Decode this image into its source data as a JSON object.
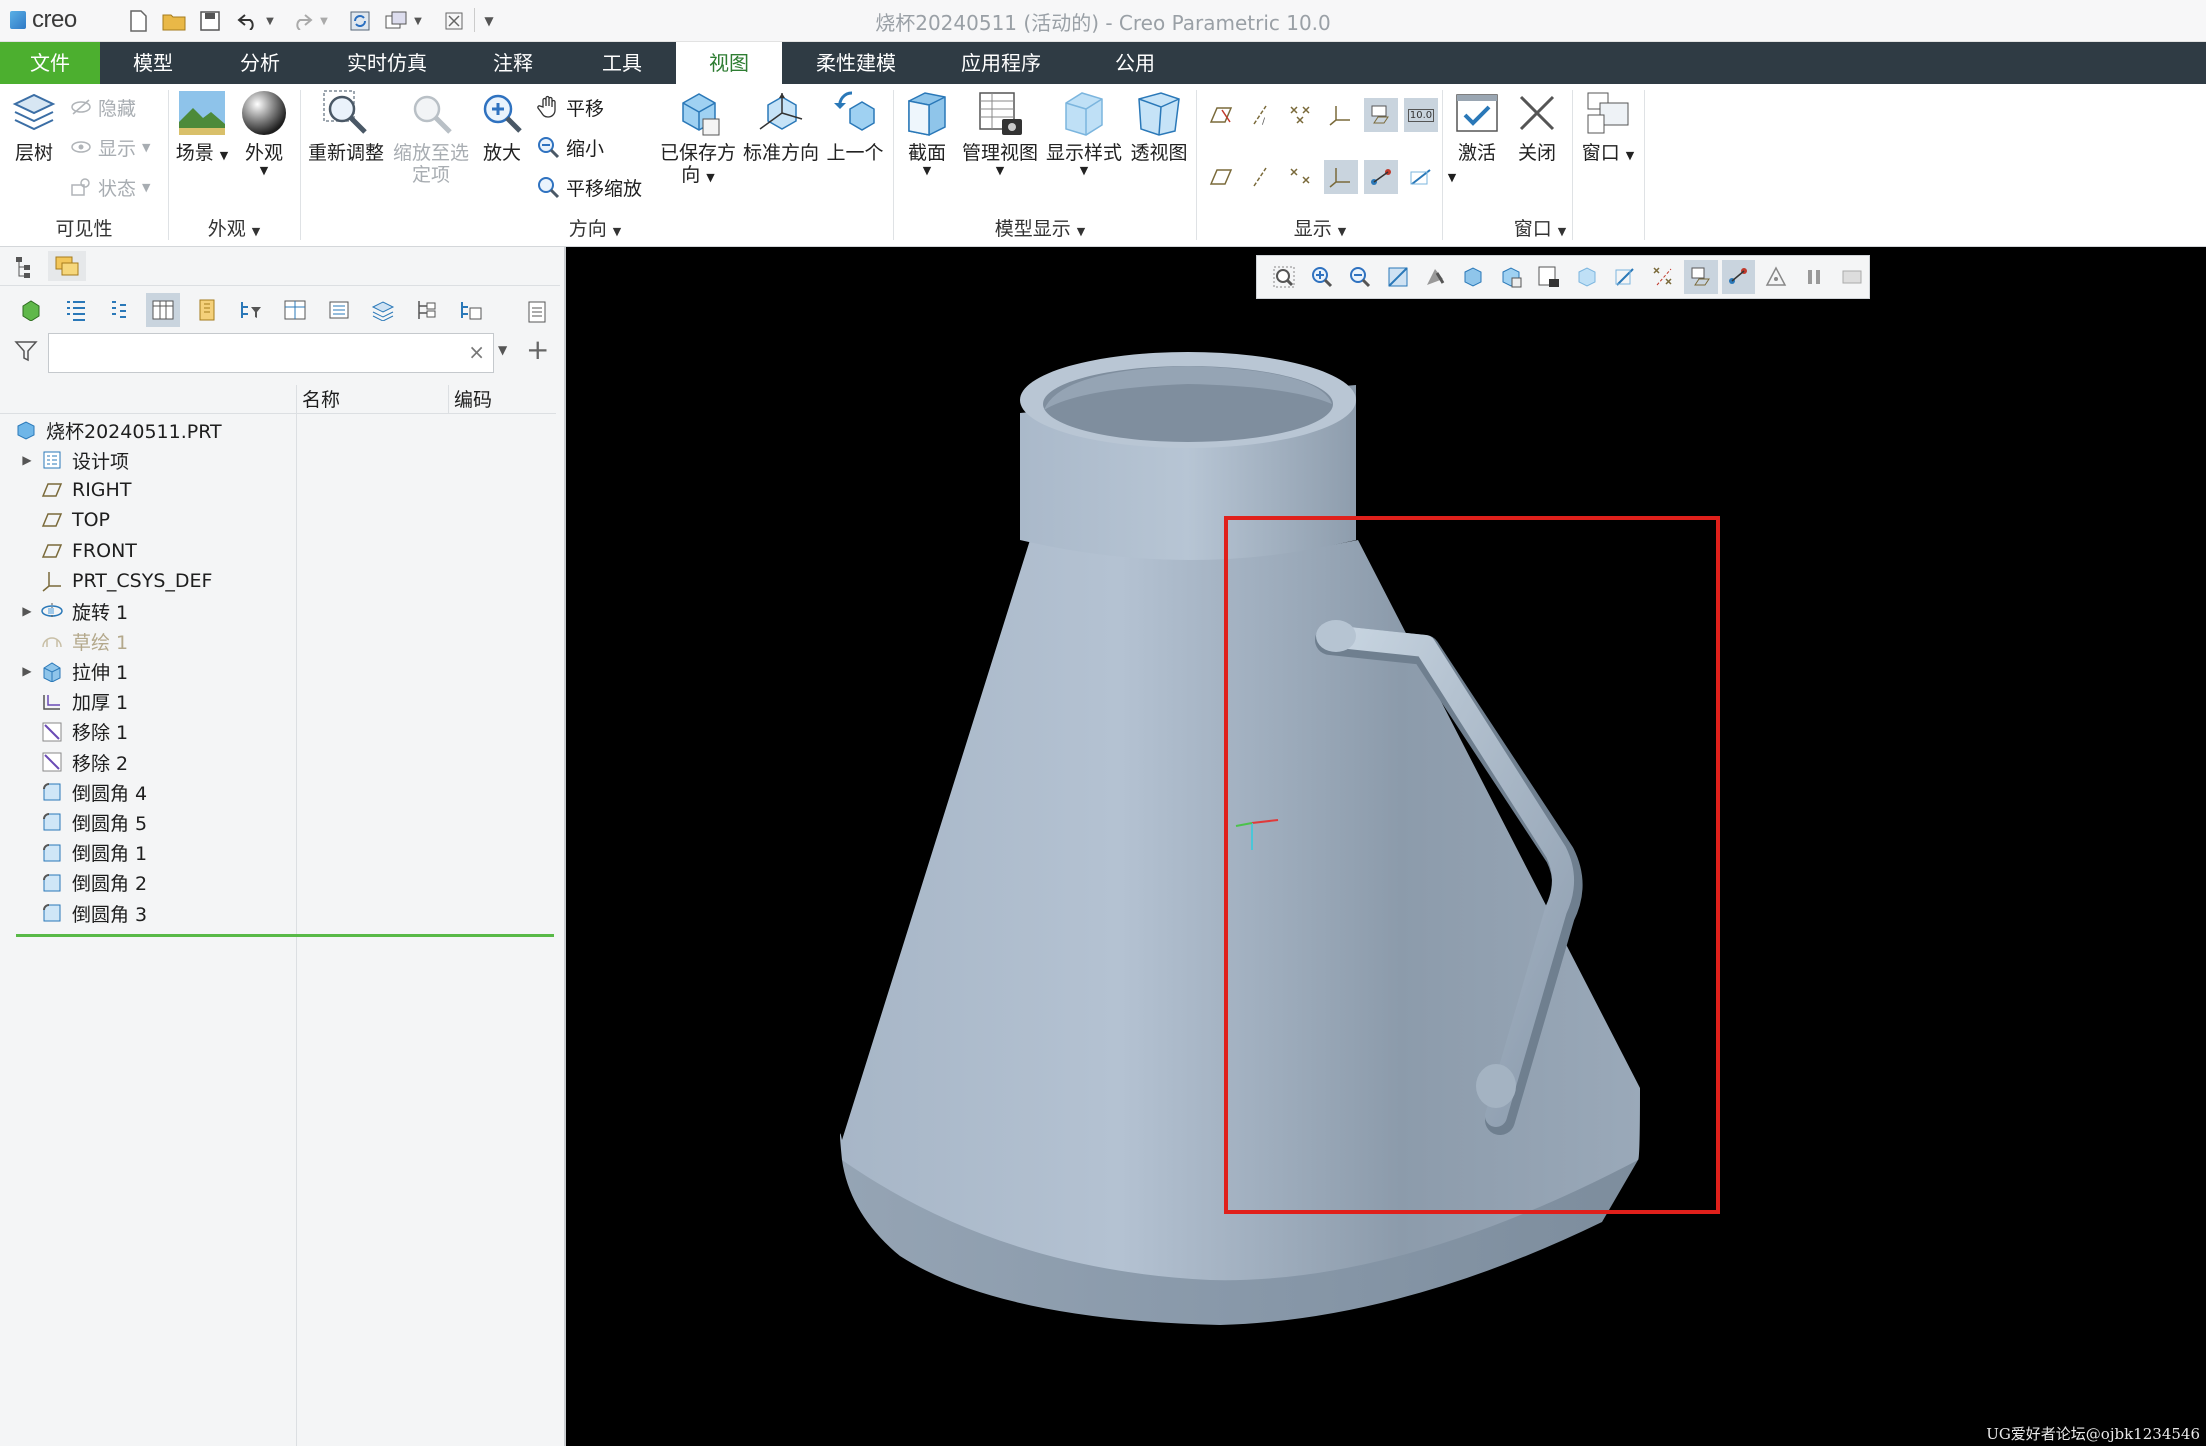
{
  "titlebar": {
    "logo_text": "creo",
    "window_title": "烧杯20240511 (活动的) - Creo Parametric 10.0"
  },
  "tabs": [
    {
      "label": "文件"
    },
    {
      "label": "模型"
    },
    {
      "label": "分析"
    },
    {
      "label": "实时仿真"
    },
    {
      "label": "注释"
    },
    {
      "label": "工具"
    },
    {
      "label": "视图"
    },
    {
      "label": "柔性建模"
    },
    {
      "label": "应用程序"
    },
    {
      "label": "公用"
    }
  ],
  "active_tab": "视图",
  "ribbon": {
    "visibility": {
      "layer_tree": "层树",
      "hide": "隐藏",
      "show": "显示",
      "status": "状态",
      "group": "可见性"
    },
    "appearance": {
      "scene": "场景",
      "appearance": "外观",
      "group": "外观"
    },
    "orientation": {
      "refit": "重新调整",
      "zoom_to_selected_1": "缩放至选",
      "zoom_to_selected_2": "定项",
      "zoom_in": "放大",
      "pan": "平移",
      "zoom_out": "缩小",
      "pan_zoom": "平移缩放",
      "saved_orient_1": "已保存方",
      "saved_orient_2": "向",
      "standard_orient": "标准方向",
      "previous": "上一个",
      "group": "方向"
    },
    "model_display": {
      "section": "截面",
      "manage_views": "管理视图",
      "display_style": "显示样式",
      "perspective": "透视图",
      "group": "模型显示"
    },
    "show": {
      "group": "显示",
      "tag": "10.0"
    },
    "window": {
      "activate": "激活",
      "close": "关闭",
      "window": "窗口",
      "group": "窗口"
    }
  },
  "model_tree": {
    "search_placeholder": "",
    "col_name": "名称",
    "col_code": "编码",
    "root": "烧杯20240511.PRT",
    "items": [
      {
        "label": "设计项",
        "icon": "design-items-icon",
        "expandable": true
      },
      {
        "label": "RIGHT",
        "icon": "datum-plane-icon",
        "expandable": false
      },
      {
        "label": "TOP",
        "icon": "datum-plane-icon",
        "expandable": false
      },
      {
        "label": "FRONT",
        "icon": "datum-plane-icon",
        "expandable": false
      },
      {
        "label": "PRT_CSYS_DEF",
        "icon": "csys-icon",
        "expandable": false
      },
      {
        "label": "旋转 1",
        "icon": "revolve-icon",
        "expandable": true
      },
      {
        "label": "草绘 1",
        "icon": "sketch-icon",
        "expandable": false,
        "dim": true
      },
      {
        "label": "拉伸 1",
        "icon": "extrude-icon",
        "expandable": true
      },
      {
        "label": "加厚 1",
        "icon": "thicken-icon",
        "expandable": false
      },
      {
        "label": "移除 1",
        "icon": "remove-icon",
        "expandable": false
      },
      {
        "label": "移除 2",
        "icon": "remove-icon",
        "expandable": false
      },
      {
        "label": "倒圆角 4",
        "icon": "round-icon",
        "expandable": false
      },
      {
        "label": "倒圆角 5",
        "icon": "round-icon",
        "expandable": false
      },
      {
        "label": "倒圆角 1",
        "icon": "round-icon",
        "expandable": false
      },
      {
        "label": "倒圆角 2",
        "icon": "round-icon",
        "expandable": false
      },
      {
        "label": "倒圆角 3",
        "icon": "round-icon",
        "expandable": false
      }
    ]
  },
  "viewport": {
    "watermark": "UG爱好者论坛@ojbk1234546",
    "highlight_color": "#e0201b",
    "model_color": "#9eaebf"
  }
}
